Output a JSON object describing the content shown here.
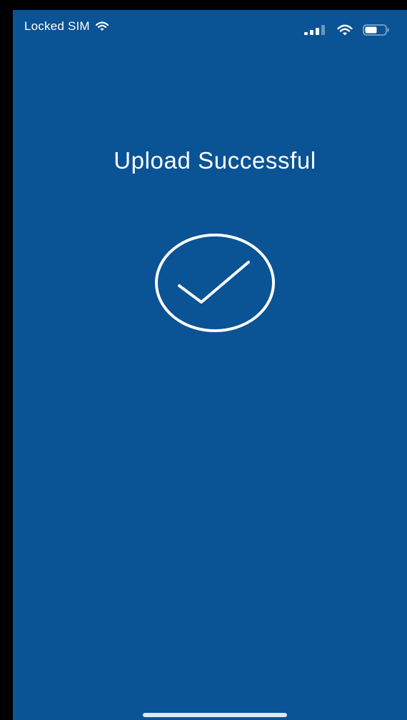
{
  "colors": {
    "background": "#0a5395",
    "foreground": "#ffffff",
    "home_indicator": "#dfe7f0"
  },
  "status_bar": {
    "carrier": "Locked SIM",
    "carrier_icon": "wifi-icon",
    "right_icons": [
      "signal-icon",
      "wifi-icon",
      "battery-icon"
    ]
  },
  "main": {
    "title": "Upload Successful",
    "status_icon": "checkmark-circle-icon"
  }
}
